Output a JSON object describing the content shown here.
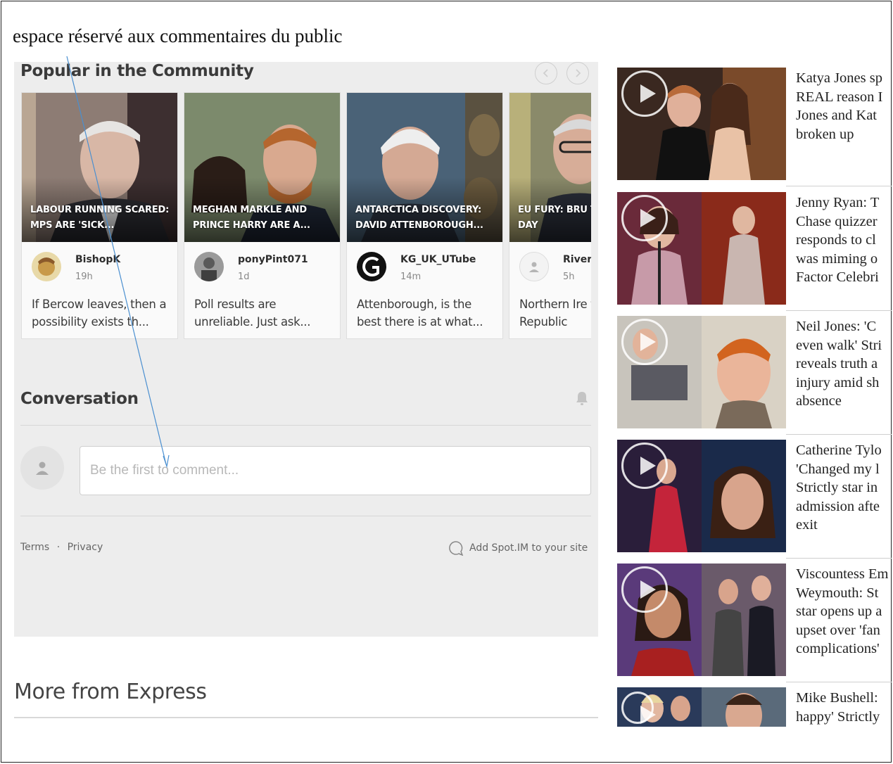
{
  "annotation": {
    "text": "espace réservé aux commentaires du public"
  },
  "popular": {
    "title": "Popular in the Community",
    "cards": [
      {
        "headline": "LABOUR RUNNING SCARED: MPS ARE 'SICK...",
        "user": "BishopK",
        "time": "19h",
        "comment": "If Bercow leaves, then a possibility exists th..."
      },
      {
        "headline": "MEGHAN MARKLE AND PRINCE HARRY ARE A...",
        "user": "ponyPint071",
        "time": "1d",
        "comment": "Poll results are unreliable. Just ask..."
      },
      {
        "headline": "ANTARCTICA DISCOVERY: DAVID ATTENBOROUGH...",
        "user": "KG_UK_UTube",
        "time": "14m",
        "comment": "Attenborough, is the best there is at what..."
      },
      {
        "headline": "EU FURY: BRU TO SCRAP DAY",
        "user": "River",
        "time": "5h",
        "comment": "Northern Ire the Republic"
      }
    ]
  },
  "conversation": {
    "title": "Conversation",
    "placeholder": "Be the first to comment..."
  },
  "footer": {
    "terms": "Terms",
    "separator": "·",
    "privacy": "Privacy",
    "add_spotim": "Add Spot.IM to your site"
  },
  "more": {
    "title": "More from Express"
  },
  "sidebar": {
    "items": [
      {
        "title": "Katya Jones sp\nREAL reason I\nJones and Kat\nbroken up"
      },
      {
        "title": "Jenny Ryan: T\nChase quizzer\nresponds to cl\nwas miming o\nFactor Celebri"
      },
      {
        "title": "Neil Jones: 'C\neven walk' Stri\nreveals truth a\ninjury amid sh\nabsence"
      },
      {
        "title": "Catherine Tylo\n'Changed my l\nStrictly star in\nadmission afte\nexit"
      },
      {
        "title": "Viscountess Em\nWeymouth: St\nstar opens up a\nupset over 'fan\ncomplications'"
      },
      {
        "title": "Mike Bushell:\nhappy' Strictly"
      }
    ]
  },
  "colors": {
    "panel_bg": "#ededed",
    "card_bg": "#fafafa",
    "arrow": "#4a8fd0"
  }
}
